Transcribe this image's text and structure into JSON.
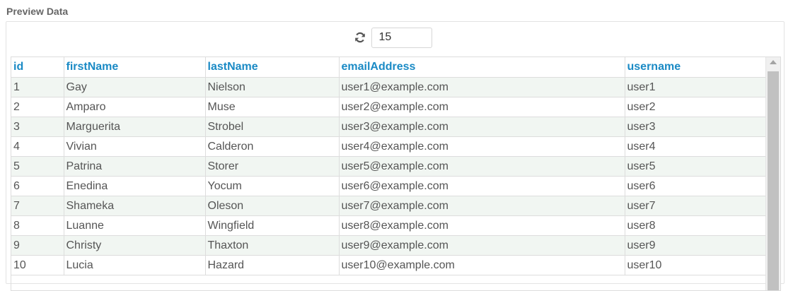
{
  "section": {
    "title": "Preview Data"
  },
  "toolbar": {
    "refresh_icon": "refresh-icon",
    "rows_value": "15"
  },
  "table": {
    "columns": [
      "id",
      "firstName",
      "lastName",
      "emailAddress",
      "username"
    ],
    "rows": [
      [
        "1",
        "Gay",
        "Nielson",
        "user1@example.com",
        "user1"
      ],
      [
        "2",
        "Amparo",
        "Muse",
        "user2@example.com",
        "user2"
      ],
      [
        "3",
        "Marguerita",
        "Strobel",
        "user3@example.com",
        "user3"
      ],
      [
        "4",
        "Vivian",
        "Calderon",
        "user4@example.com",
        "user4"
      ],
      [
        "5",
        "Patrina",
        "Storer",
        "user5@example.com",
        "user5"
      ],
      [
        "6",
        "Enedina",
        "Yocum",
        "user6@example.com",
        "user6"
      ],
      [
        "7",
        "Shameka",
        "Oleson",
        "user7@example.com",
        "user7"
      ],
      [
        "8",
        "Luanne",
        "Wingfield",
        "user8@example.com",
        "user8"
      ],
      [
        "9",
        "Christy",
        "Thaxton",
        "user9@example.com",
        "user9"
      ],
      [
        "10",
        "Lucia",
        "Hazard",
        "user10@example.com",
        "user10"
      ]
    ]
  },
  "colors": {
    "header_text": "#1a8ac5",
    "odd_row": "#f1f6f2",
    "accent_green": "#5cb85c"
  }
}
